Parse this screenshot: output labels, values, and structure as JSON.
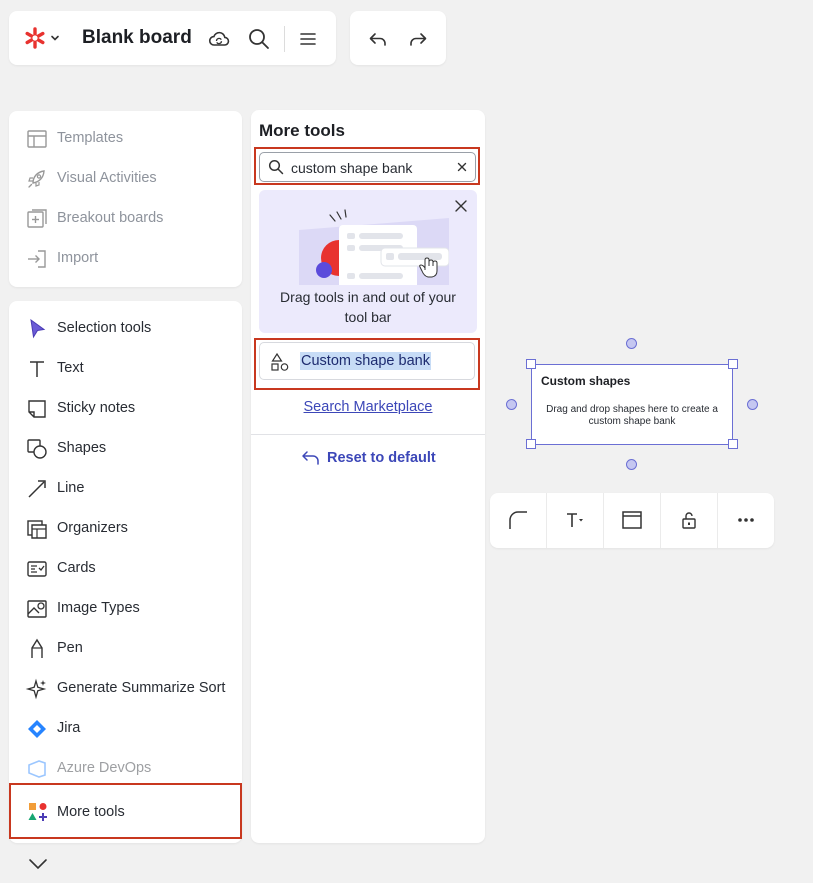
{
  "app": {
    "board_title": "Blank board",
    "brand_color": "#e8322f"
  },
  "left_top_items": [
    {
      "label": "Templates",
      "icon": "templates-icon"
    },
    {
      "label": "Visual Activities",
      "icon": "rocket-icon"
    },
    {
      "label": "Breakout boards",
      "icon": "breakout-icon"
    },
    {
      "label": "Import",
      "icon": "import-icon"
    }
  ],
  "left_tools": [
    {
      "label": "Selection tools",
      "icon": "cursor-icon"
    },
    {
      "label": "Text",
      "icon": "text-icon"
    },
    {
      "label": "Sticky notes",
      "icon": "sticky-note-icon"
    },
    {
      "label": "Shapes",
      "icon": "shapes-icon"
    },
    {
      "label": "Line",
      "icon": "line-icon"
    },
    {
      "label": "Organizers",
      "icon": "organizers-icon"
    },
    {
      "label": "Cards",
      "icon": "cards-icon"
    },
    {
      "label": "Image Types",
      "icon": "image-icon"
    },
    {
      "label": "Pen",
      "icon": "pen-icon"
    },
    {
      "label": "Generate Summarize Sort",
      "icon": "sparkle-icon"
    },
    {
      "label": "Jira",
      "icon": "jira-icon"
    },
    {
      "label": "Azure DevOps",
      "icon": "azure-icon"
    }
  ],
  "more_tools_item": {
    "label": "More tools"
  },
  "panel": {
    "title": "More tools",
    "search_value": "custom shape bank",
    "promo_text": "Drag tools in and out of your tool bar",
    "result_label": "Custom shape bank",
    "marketplace_link": "Search Marketplace",
    "reset_label": "Reset to default"
  },
  "canvas_shape": {
    "title": "Custom shapes",
    "description": "Drag and drop shapes here to create a custom shape bank"
  },
  "accent_color": "#3c47b8",
  "highlight_color": "#c8381f"
}
